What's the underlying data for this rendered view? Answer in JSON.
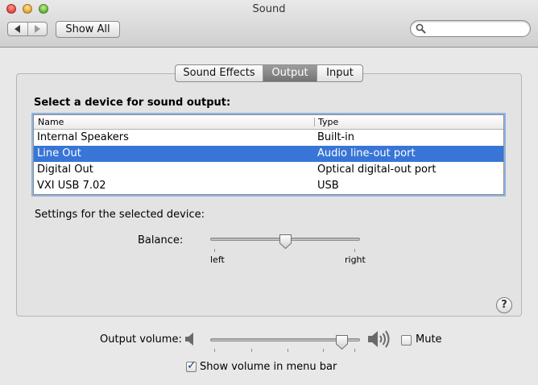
{
  "window": {
    "title": "Sound"
  },
  "toolbar": {
    "show_all_label": "Show All",
    "search_placeholder": ""
  },
  "tabs": [
    {
      "label": "Sound Effects",
      "selected": false
    },
    {
      "label": "Output",
      "selected": true
    },
    {
      "label": "Input",
      "selected": false
    }
  ],
  "output": {
    "heading": "Select a device for sound output:",
    "columns": {
      "name": "Name",
      "type": "Type"
    },
    "devices": [
      {
        "name": "Internal Speakers",
        "type": "Built-in",
        "selected": false
      },
      {
        "name": "Line Out",
        "type": "Audio line-out port",
        "selected": true
      },
      {
        "name": "Digital Out",
        "type": "Optical digital-out port",
        "selected": false
      },
      {
        "name": "VXI USB 7.02",
        "type": "USB",
        "selected": false
      }
    ],
    "settings_label": "Settings for the selected device:",
    "balance": {
      "label": "Balance:",
      "left_label": "left",
      "right_label": "right",
      "value": 0.5
    }
  },
  "footer": {
    "volume_label": "Output volume:",
    "volume_value": 0.92,
    "mute_label": "Mute",
    "mute_checked": false,
    "menubar_label": "Show volume in menu bar",
    "menubar_checked": true
  },
  "help_glyph": "?",
  "colors": {
    "selection": "#3875d7",
    "selected_tab": "#858585"
  },
  "icons": [
    "search-icon",
    "back-arrow-icon",
    "forward-arrow-icon",
    "speaker-low-icon",
    "speaker-high-icon",
    "help-icon",
    "checkmark-icon"
  ]
}
